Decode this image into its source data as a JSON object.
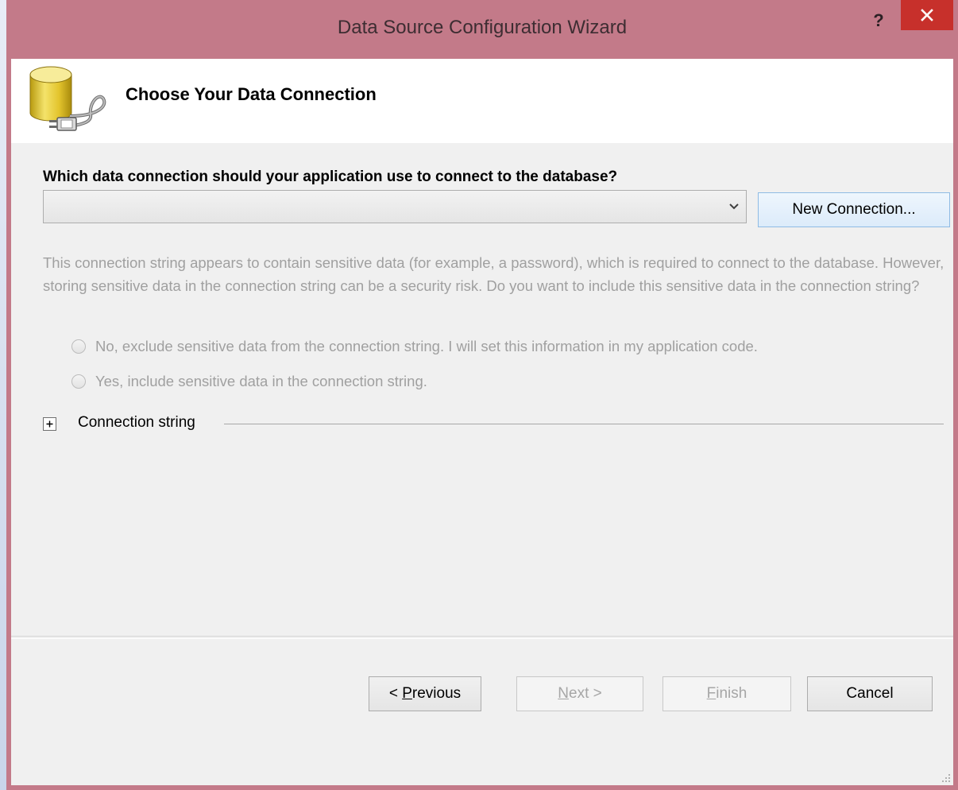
{
  "window": {
    "title": "Data Source Configuration Wizard",
    "help_label": "?",
    "colors": {
      "frame": "#c37a89",
      "close": "#c7302b",
      "client": "#f0f0f0"
    }
  },
  "header": {
    "title": "Choose Your Data Connection",
    "icon": "database-plug-icon"
  },
  "connection": {
    "question": "Which data connection should your application use to connect to the database?",
    "selected_value": "",
    "new_connection_label": "New Connection..."
  },
  "sensitive": {
    "description": "This connection string appears to contain sensitive data (for example, a password), which is required to connect to the database. However, storing sensitive data in the connection string can be a security risk. Do you want to include this sensitive data in the connection string?",
    "option_exclude": "No, exclude sensitive data from the connection string. I will set this information in my application code.",
    "option_include": "Yes, include sensitive data in the connection string."
  },
  "connection_string": {
    "label": "Connection string",
    "expander_symbol": "+"
  },
  "footer": {
    "previous": {
      "accel": "P",
      "rest": "revious",
      "prefix": "< "
    },
    "next": {
      "accel": "N",
      "rest": "ext >"
    },
    "finish": {
      "accel": "F",
      "rest": "inish"
    },
    "cancel": "Cancel"
  }
}
